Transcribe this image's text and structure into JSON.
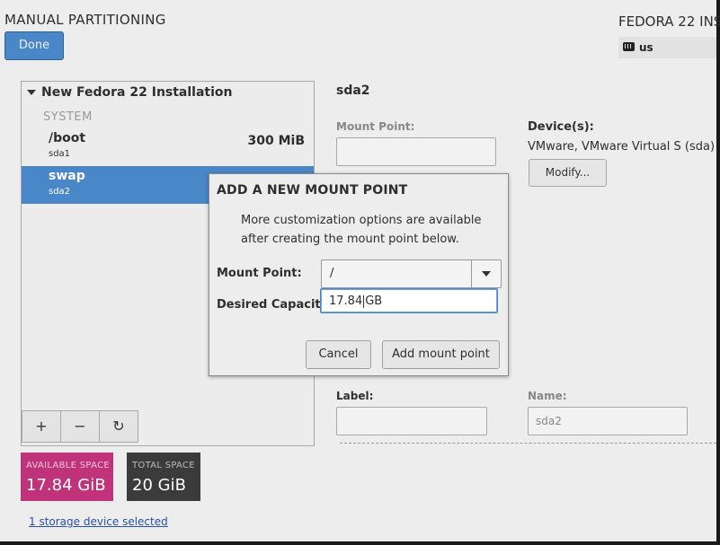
{
  "header": {
    "title": "MANUAL PARTITIONING",
    "done_label": "Done",
    "product": "FEDORA 22 INS",
    "keyboard_layout": "us"
  },
  "left_panel": {
    "tree_title": "New Fedora 22 Installation",
    "section": "SYSTEM",
    "partitions": [
      {
        "name": "/boot",
        "device": "sda1",
        "size": "300 MiB",
        "selected": false
      },
      {
        "name": "swap",
        "device": "sda2",
        "size": "",
        "selected": true
      }
    ],
    "tools": {
      "add": "+",
      "remove": "−",
      "refresh": "↻"
    }
  },
  "space": {
    "available_label": "AVAILABLE SPACE",
    "available_value": "17.84 GiB",
    "total_label": "TOTAL SPACE",
    "total_value": "20 GiB"
  },
  "storage_link": "1 storage device selected",
  "right_panel": {
    "title": "sda2",
    "mount_point_label": "Mount Point:",
    "devices_label": "Device(s):",
    "devices_value": "VMware, VMware Virtual S (sda)",
    "modify_label": "Modify...",
    "label_label": "Label:",
    "name_label": "Name:",
    "name_value": "sda2"
  },
  "dialog": {
    "title": "ADD A NEW MOUNT POINT",
    "description": "More customization options are available after creating the mount point below.",
    "mount_point_label": "Mount Point:",
    "mount_point_value": "/",
    "capacity_label": "Desired Capacity:",
    "capacity_before_cursor": "17.84",
    "capacity_after_cursor": "GB",
    "cancel_label": "Cancel",
    "add_label": "Add mount point"
  },
  "colors": {
    "accent": "#4a87c8",
    "available_space": "#c0337a",
    "total_space": "#3b3b3b"
  }
}
